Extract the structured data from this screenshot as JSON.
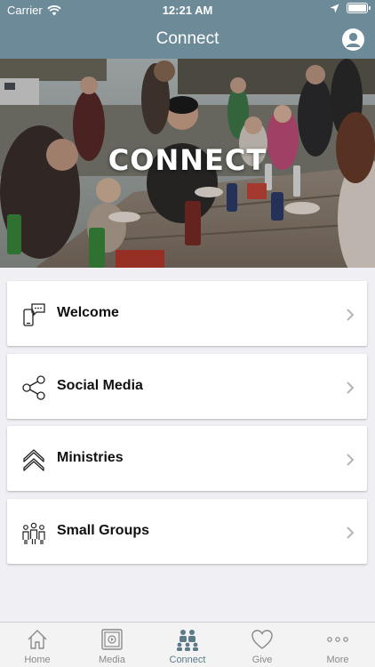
{
  "status_bar": {
    "carrier": "Carrier",
    "time": "12:21 AM"
  },
  "nav": {
    "title": "Connect",
    "profile_icon": "user-circle-icon"
  },
  "hero": {
    "title": "CONNECT"
  },
  "menu": {
    "items": [
      {
        "label": "Welcome",
        "icon": "chat-phone-icon"
      },
      {
        "label": "Social Media",
        "icon": "share-icon"
      },
      {
        "label": "Ministries",
        "icon": "double-chevron-up-icon"
      },
      {
        "label": "Small Groups",
        "icon": "people-group-icon"
      }
    ]
  },
  "tabbar": {
    "tabs": [
      {
        "label": "Home",
        "icon": "home-icon",
        "active": false
      },
      {
        "label": "Media",
        "icon": "media-icon",
        "active": false
      },
      {
        "label": "Connect",
        "icon": "connect-icon",
        "active": true
      },
      {
        "label": "Give",
        "icon": "heart-icon",
        "active": false
      },
      {
        "label": "More",
        "icon": "more-dots-icon",
        "active": false
      }
    ]
  },
  "colors": {
    "nav_bg": "#6d8a99",
    "active_tab": "#5c7a88",
    "inactive_tab": "#8a8a8a",
    "page_bg": "#efeff4"
  }
}
